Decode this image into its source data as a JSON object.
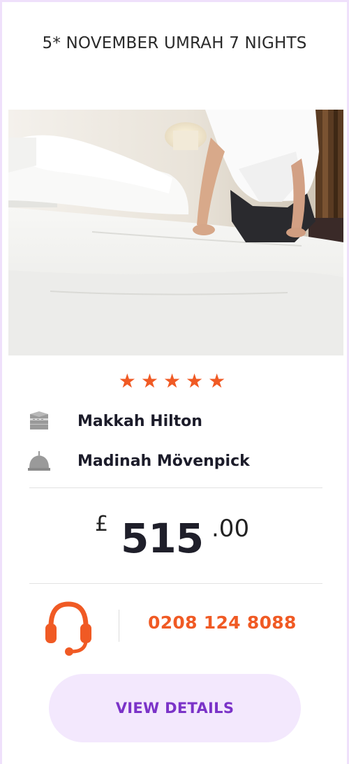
{
  "package": {
    "title": "5* NOVEMBER UMRAH 7 NIGHTS",
    "rating_stars": 5,
    "stars_text": "★★★★★",
    "hotels": [
      {
        "name": "Makkah Hilton",
        "icon": "kaaba-icon"
      },
      {
        "name": "Madinah Mövenpick",
        "icon": "mosque-dome-icon"
      }
    ],
    "price": {
      "currency": "£",
      "amount": "515",
      "decimals": ".00"
    },
    "contact": {
      "phone": "0208 124 8088",
      "icon": "headset-icon"
    },
    "view_details_label": "VIEW DETAILS"
  },
  "colors": {
    "accent": "#f05a24",
    "button_bg": "#f3e8fd",
    "button_text": "#7b33c8",
    "border": "#efe0fb"
  }
}
